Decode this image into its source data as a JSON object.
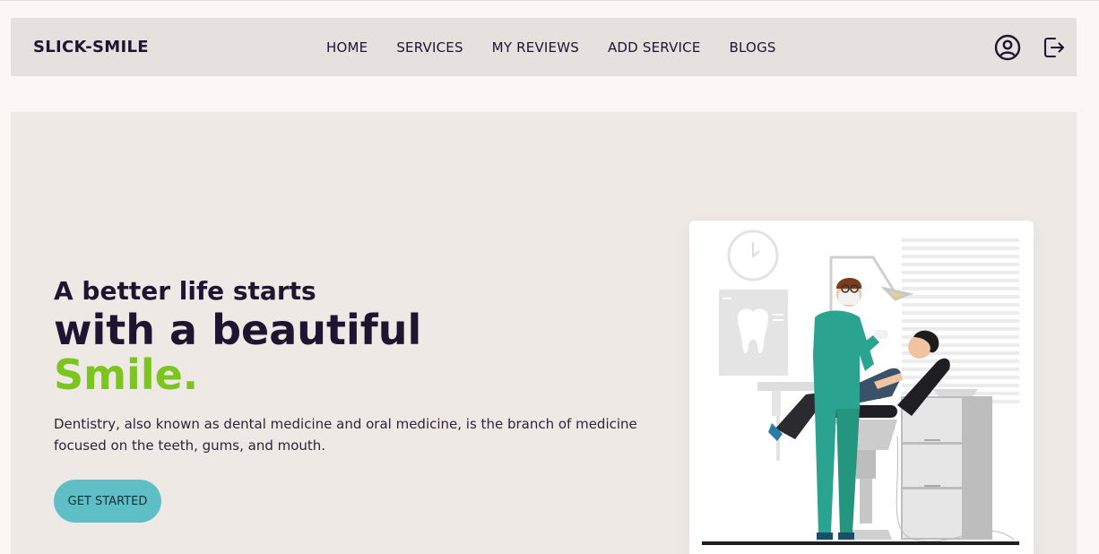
{
  "navbar": {
    "brand": "SLICK-SMILE",
    "links": [
      {
        "label": "HOME"
      },
      {
        "label": "SERVICES"
      },
      {
        "label": "MY REVIEWS"
      },
      {
        "label": "ADD SERVICE"
      },
      {
        "label": "BLOGS"
      }
    ],
    "icons": [
      "user-profile-icon",
      "logout-icon"
    ]
  },
  "hero": {
    "line1": "A better life starts",
    "line2": "with a beautiful",
    "line3": "Smile.",
    "description": "Dentistry, also known as dental medicine and oral medicine, is the branch of medicine focused on the teeth, gums, and mouth.",
    "cta_label": "GET STARTED"
  },
  "colors": {
    "accent_green": "#7cc41e",
    "button_teal": "#5fbfc6",
    "dark_text": "#1f1530",
    "nav_bg": "#e6e0de",
    "hero_bg": "#efe9e6"
  }
}
